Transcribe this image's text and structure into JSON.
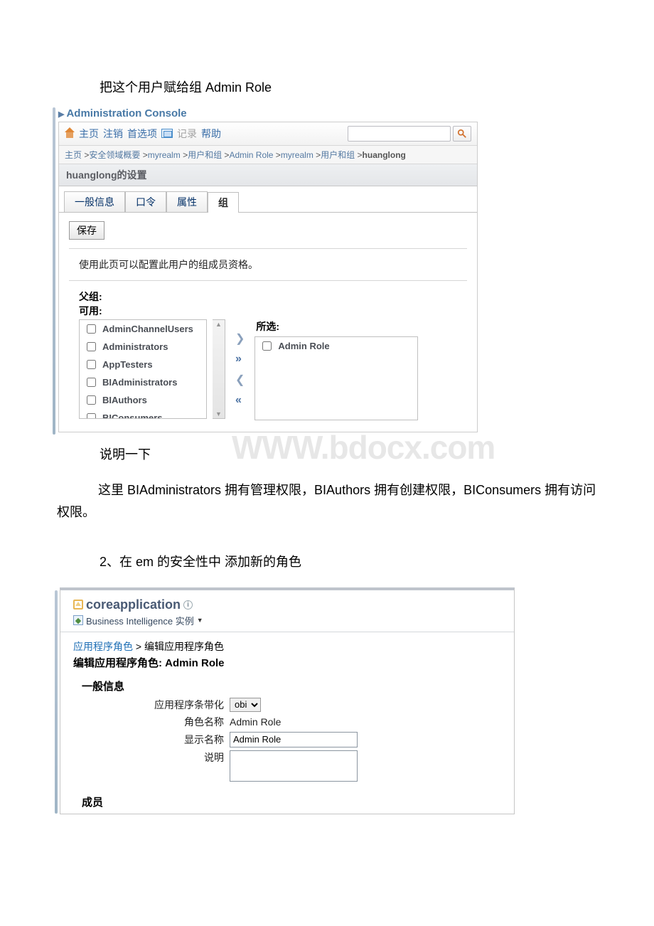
{
  "doc": {
    "intro": "把这个用户赋给组 Admin Role",
    "console_title": "Administration Console",
    "toolbar": {
      "home": "主页",
      "logout": "注销",
      "pref": "首选项",
      "record": "记录",
      "help": "帮助"
    },
    "breadcrumb": [
      "主页",
      "安全领域概要",
      "myrealm",
      "用户和组",
      "Admin Role",
      "myrealm",
      "用户和组",
      "huanglong"
    ],
    "page_header": "huanglong的设置",
    "tabs": [
      "一般信息",
      "口令",
      "属性",
      "组"
    ],
    "save": "保存",
    "help_text": "使用此页可以配置此用户的组成员资格。",
    "parent_label": "父组:",
    "avail_label": "可用:",
    "available": [
      "AdminChannelUsers",
      "Administrators",
      "AppTesters",
      "BIAdministrators",
      "BIAuthors",
      "BIConsumers"
    ],
    "selected_label": "所选:",
    "selected": [
      "Admin Role"
    ],
    "explain_prefix": "说明一下",
    "watermark": "WWW.bdocx.com",
    "explain_body": "这里 BIAdministrators 拥有管理权限，BIAuthors 拥有创建权限，BIConsumers 拥有访问权限。",
    "step2": "2、在 em 的安全性中 添加新的角色"
  },
  "em": {
    "title": "coreapplication",
    "subtitle": "Business Intelligence 实例",
    "crumb_link": "应用程序角色",
    "crumb_tail": " > 编辑应用程序角色",
    "heading": "编辑应用程序角色: Admin Role",
    "section_general": "一般信息",
    "labels": {
      "stripe": "应用程序条带化",
      "role_name": "角色名称",
      "display_name": "显示名称",
      "desc": "说明"
    },
    "values": {
      "stripe": "obi",
      "role_name": "Admin Role",
      "display_name": "Admin Role"
    },
    "section_members": "成员"
  }
}
